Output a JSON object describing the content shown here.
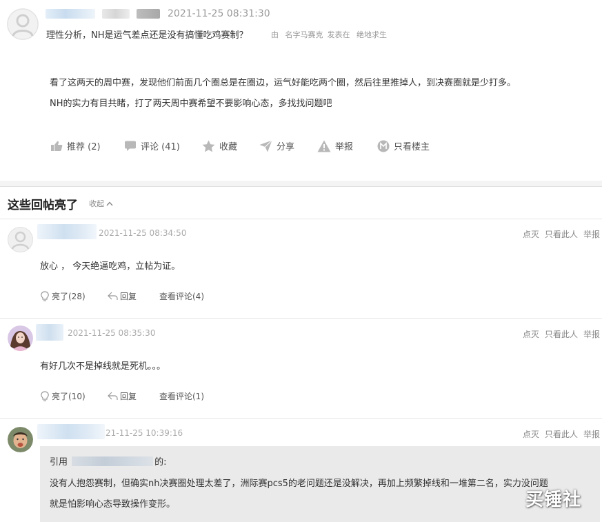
{
  "post": {
    "time": "2021-11-25 08:31:30",
    "title": "理性分析，NH是运气差点还是没有搞懂吃鸡赛制？",
    "meta_by": "由",
    "meta_author": "名字马赛克",
    "meta_posted_in": "发表在",
    "meta_forum": "绝地求生",
    "body": [
      "看了这两天的周中赛，发现他们前面几个圈总是在圈边，运气好能吃两个圈，然后往里推掉人，到决赛圈就是少打多。",
      "NH的实力有目共睹，打了两天周中赛希望不要影响心态，多找找问题吧"
    ],
    "actions": {
      "recommend": "推荐 (2)",
      "comment": "评论 (41)",
      "favorite": "收藏",
      "share": "分享",
      "report": "举报",
      "author_only": "只看楼主"
    }
  },
  "section": {
    "title": "这些回帖亮了",
    "collapse": "收起"
  },
  "replies": [
    {
      "time": "2021-11-25 08:34:50",
      "text": "放心 ， 今天绝逼吃鸡，立帖为证。",
      "light": "亮了(28)",
      "reply": "回复",
      "view": "查看评论(4)",
      "op_extinguish": "点灭",
      "op_only": "只看此人",
      "op_report": "举报"
    },
    {
      "time": "2021-11-25 08:35:30",
      "text": "有好几次不是掉线就是死机。。。",
      "light": "亮了(10)",
      "reply": "回复",
      "view": "查看评论(1)",
      "op_extinguish": "点灭",
      "op_only": "只看此人",
      "op_report": "举报"
    },
    {
      "time": "21-11-25 10:39:16",
      "op_extinguish": "点灭",
      "op_only": "只看此人",
      "op_report": "举报",
      "quote_prefix": "引用",
      "quote_suffix": "的:",
      "quote_text": [
        "没有人抱怨赛制，但确实nh决赛圈处理太差了，洲际赛pcs5的老问题还是没解决，再加上频繁掉线和一堆第二名，实力没问题",
        "就是怕影响心态导致操作变形。"
      ]
    }
  ],
  "watermark": "买锤社",
  "colors": {
    "muted": "#999999",
    "text": "#333333",
    "quote_bg": "#eaeaea"
  }
}
